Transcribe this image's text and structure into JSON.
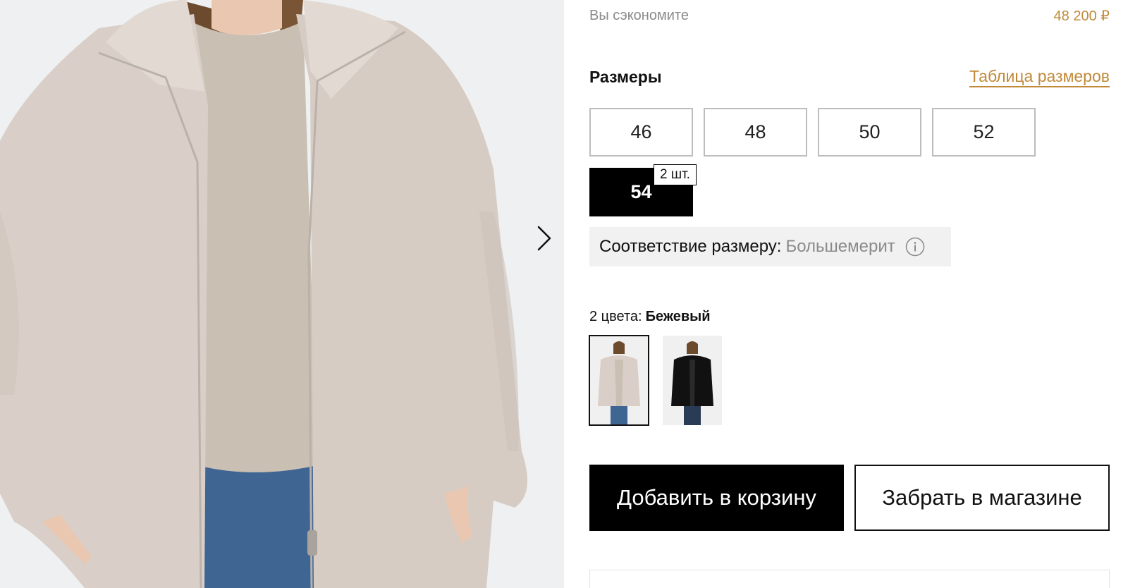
{
  "gallery": {
    "next_icon": "chevron-right-icon",
    "photo_colors": {
      "background": "#eef0f1",
      "coat": "#d9cfc8",
      "sweater": "#c9bfb2",
      "jeans": "#3f6593",
      "hair": "#6b4a2e"
    }
  },
  "savings": {
    "label": "Вы сэкономите",
    "value": "48 200 ₽"
  },
  "sizes": {
    "title": "Размеры",
    "table_link": "Таблица размеров",
    "options": [
      {
        "label": "46",
        "selected": false
      },
      {
        "label": "48",
        "selected": false
      },
      {
        "label": "50",
        "selected": false
      },
      {
        "label": "52",
        "selected": false
      },
      {
        "label": "54",
        "selected": true
      }
    ],
    "stock_badge": "2 шт."
  },
  "fit": {
    "label": "Соответствие размеру:",
    "value": "Большемерит",
    "info_icon": "info-icon"
  },
  "colors": {
    "count_label": "2 цвета:",
    "selected_name": "Бежевый",
    "swatches": [
      {
        "coat_color": "#d9cfc8",
        "active": true
      },
      {
        "coat_color": "#111111",
        "active": false
      }
    ]
  },
  "actions": {
    "add_to_cart": "Добавить в корзину",
    "pickup_in_store": "Забрать в магазине"
  },
  "theme": {
    "accent": "#c0893a",
    "primary": "#000000",
    "muted_text": "#8a8a8a",
    "fit_background": "#f1f1f1"
  }
}
